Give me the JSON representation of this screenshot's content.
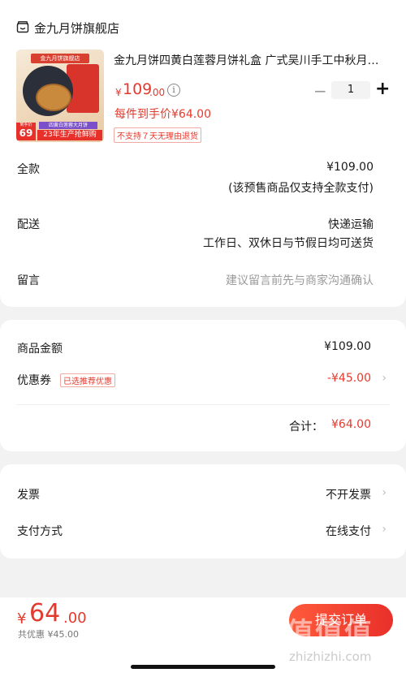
{
  "store": {
    "name": "金九月饼旗舰店",
    "icon": "store-icon"
  },
  "product": {
    "title": "金九月饼四黄白莲蓉月饼礼盒 广式吴川手工中秋月饼礼盒装",
    "price_symbol": "¥",
    "price_int": "109",
    "price_cents": ".00",
    "per_hand_price": "每件到手价¥64.00",
    "no_return": "不支持７天无理由退货",
    "quantity": "1",
    "minus_label": "−",
    "plus_label": "+",
    "thumb": {
      "store_tag": "金九月饼旗舰店",
      "price_badge": "69",
      "price_badge_prefix": "到手价",
      "ribbon_line1": "四黄白莲蓉大月饼",
      "ribbon_line2": "23年生产抢鲜购"
    }
  },
  "payment_rows": {
    "full_label": "全款",
    "full_value": "¥109.00",
    "full_note": "(该预售商品仅支持全款支付)",
    "shipping_label": "配送",
    "shipping_value": "快递运输",
    "shipping_note": "工作日、双休日与节假日均可送货",
    "message_label": "留言",
    "message_placeholder": "建议留言前先与商家沟通确认"
  },
  "summary": {
    "goods_amount_label": "商品金额",
    "goods_amount_value": "¥109.00",
    "coupon_label": "优惠券",
    "coupon_badge": "已选推荐优惠",
    "coupon_value": "-¥45.00",
    "total_label": "合计：",
    "total_value": "¥64.00"
  },
  "invoice": {
    "invoice_label": "发票",
    "invoice_value": "不开发票",
    "paymethod_label": "支付方式",
    "paymethod_value": "在线支付"
  },
  "bottom": {
    "symbol": "¥",
    "amount_int": "64",
    "amount_cents": ".00",
    "saved_text": "共优惠 ¥45.00",
    "submit_label": "提交订单"
  },
  "watermark": {
    "text": "值值值",
    "url": "zhizhizhi.com"
  },
  "colors": {
    "accent": "#e43a2e",
    "background": "#f2f2f2"
  },
  "chevron": "›"
}
